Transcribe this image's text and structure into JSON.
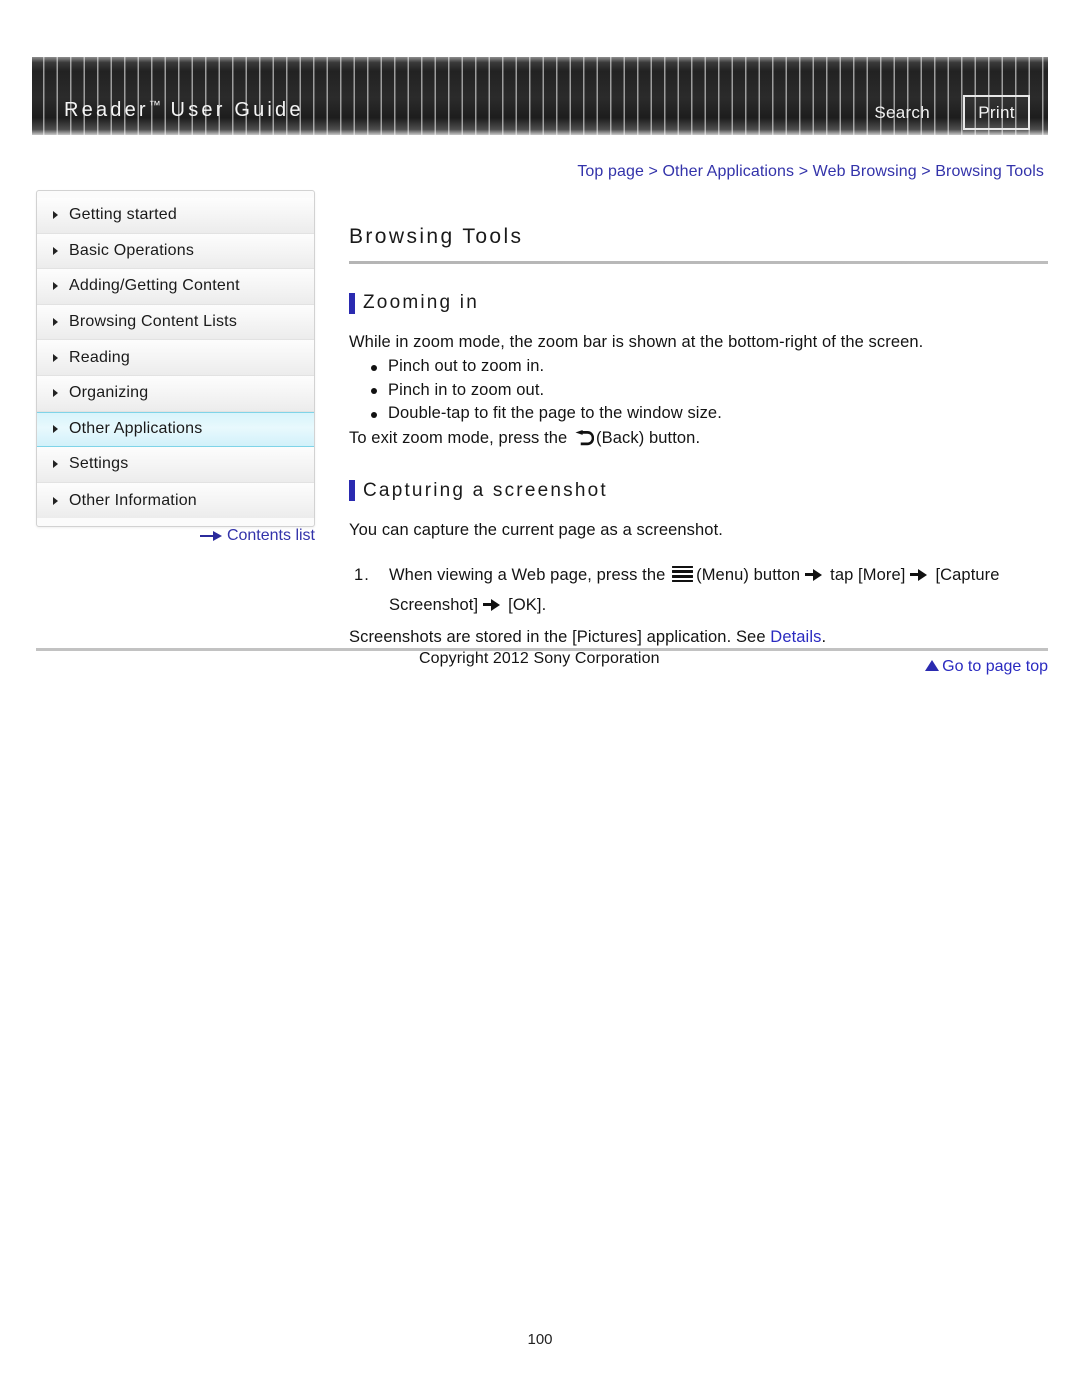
{
  "header": {
    "title_main": "Reader",
    "title_tm": "™",
    "title_rest": " User Guide",
    "search_label": "Search",
    "print_label": "Print"
  },
  "breadcrumb": {
    "items": [
      "Top page",
      "Other Applications",
      "Web Browsing",
      "Browsing Tools"
    ],
    "separator": ">",
    "full_text": "Top page > Other Applications > Web Browsing > Browsing Tools",
    "color": "#3333aa"
  },
  "sidebar": {
    "items": [
      {
        "label": "Getting started",
        "active": false
      },
      {
        "label": "Basic Operations",
        "active": false
      },
      {
        "label": "Adding/Getting Content",
        "active": false
      },
      {
        "label": "Browsing Content Lists",
        "active": false
      },
      {
        "label": "Reading",
        "active": false
      },
      {
        "label": "Organizing",
        "active": false
      },
      {
        "label": "Other Applications",
        "active": true
      },
      {
        "label": "Settings",
        "active": false
      },
      {
        "label": "Other Information",
        "active": false
      }
    ],
    "contents_link": "Contents list",
    "active_color": "#d8f4fb"
  },
  "main": {
    "page_title": "Browsing Tools",
    "sections": [
      {
        "heading": "Zooming in",
        "intro": "While in zoom mode, the zoom bar is shown at the bottom-right of the screen.",
        "bullets": [
          "Pinch out to zoom in.",
          "Pinch in to zoom out.",
          "Double-tap to fit the page to the window size."
        ],
        "outro_before": "To exit zoom mode, press the",
        "outro_after": "(Back) button."
      },
      {
        "heading": "Capturing a screenshot",
        "intro": "You can capture the current page as a screenshot.",
        "step1_a": "When viewing a Web page, press the",
        "step1_b": "(Menu) button",
        "step1_c": "tap [More]",
        "step1_d": "[Capture Screenshot]",
        "step1_e": "[OK].",
        "note_before": "Screenshots are stored in the [Pictures] application. See",
        "note_link": "Details",
        "note_after": "."
      }
    ],
    "go_to_top": "Go to page top"
  },
  "footer": {
    "copyright": "Copyright 2012 Sony Corporation",
    "page_number": "100"
  }
}
